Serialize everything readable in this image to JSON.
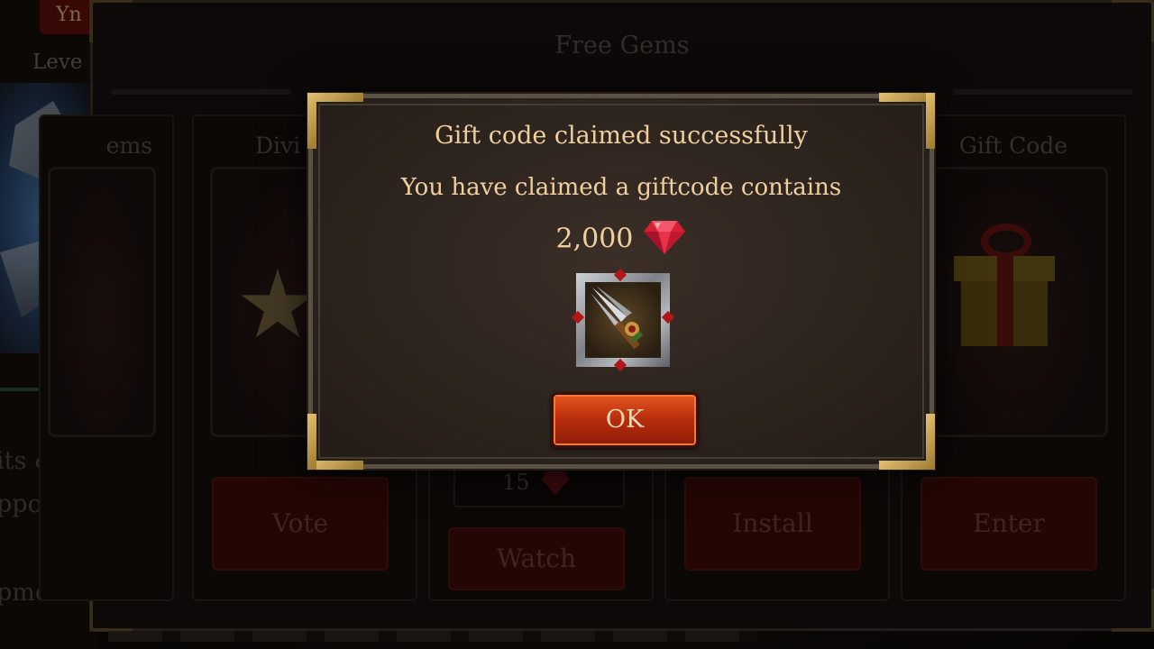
{
  "background": {
    "sidebar": {
      "top_button_label": "Yn",
      "level_label": "Leve",
      "links": [
        "its &",
        "pport",
        "pments"
      ]
    },
    "panel": {
      "title": "Free Gems",
      "cards": [
        {
          "title": "ems",
          "button_label": ""
        },
        {
          "title": "Divi",
          "button_label": "Vote"
        },
        {
          "title": "",
          "button_label": "Watch",
          "cost": "15"
        },
        {
          "title": "",
          "button_label": "Install"
        },
        {
          "title": "Gift Code",
          "button_label": "Enter"
        }
      ]
    }
  },
  "modal": {
    "title": "Gift code claimed successfully",
    "message": "You have claimed a giftcode contains",
    "reward_amount": "2,000",
    "reward_icon": "ruby-gem-icon",
    "item_icon": "spear-weapon-icon",
    "ok_label": "OK"
  },
  "colors": {
    "text_gold": "#efcf9e",
    "ok_button": "#c9360f",
    "gem_red": "#e0263c",
    "frame_gold": "#c9a24a"
  }
}
